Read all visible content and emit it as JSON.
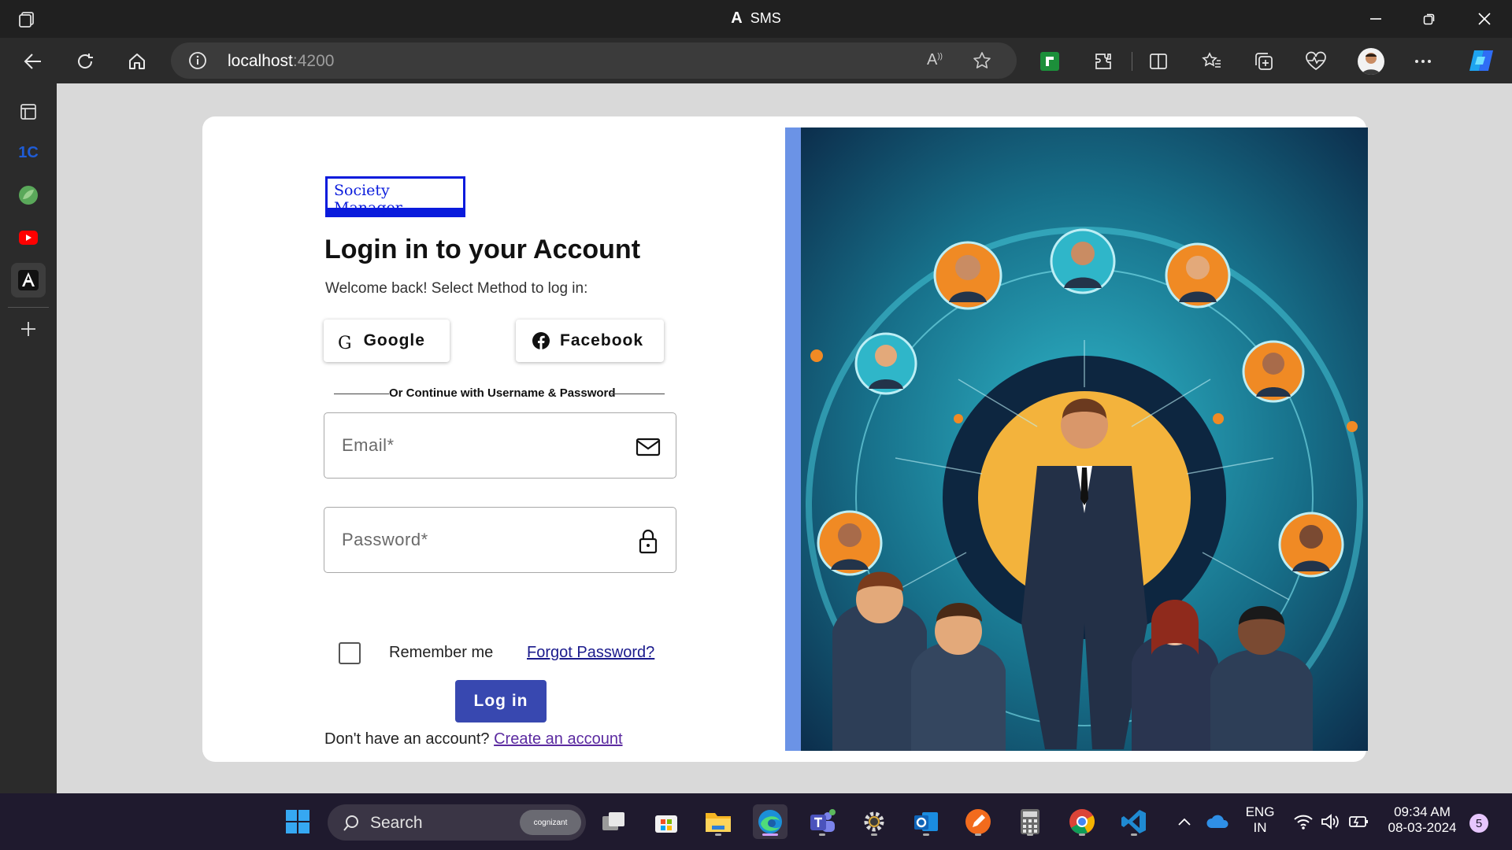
{
  "window": {
    "title": "SMS",
    "controls": [
      "minimize-icon",
      "restore-icon",
      "close-icon"
    ]
  },
  "browser": {
    "url_host": "localhost",
    "url_port": ":4200",
    "toolbar_icons": [
      "read-aloud-icon",
      "favorite-star-icon",
      "extension-green-icon",
      "extensions-icon",
      "split-screen-icon",
      "favorites-icon",
      "collections-icon",
      "browser-essentials-icon",
      "profile-avatar",
      "more-icon",
      "copilot-icon"
    ]
  },
  "sidebar": {
    "items": [
      "tab-actions-icon",
      "onec-icon",
      "leaf-app-icon",
      "youtube-icon",
      "angular-app-icon",
      "add-icon"
    ],
    "onec_label": "1C"
  },
  "login": {
    "brand": "Society Manager",
    "heading": "Login in to your Account",
    "subtext": "Welcome back! Select Method to log in:",
    "google_label": "Google",
    "google_glyph": "G",
    "facebook_label": "Facebook",
    "divider_text": "Or Continue with Username & Password",
    "email_placeholder": "Email*",
    "password_placeholder": "Password*",
    "remember_label": "Remember me",
    "forgot_label": "Forgot Password?",
    "login_label": "Log in",
    "signup_prompt": "Don't have an account?",
    "signup_link": "Create an account"
  },
  "taskbar": {
    "search_label": "Search",
    "search_badge": "cognizant",
    "language_top": "ENG",
    "language_bottom": "IN",
    "time": "09:34 AM",
    "date": "08-03-2024",
    "notification_count": "5"
  }
}
